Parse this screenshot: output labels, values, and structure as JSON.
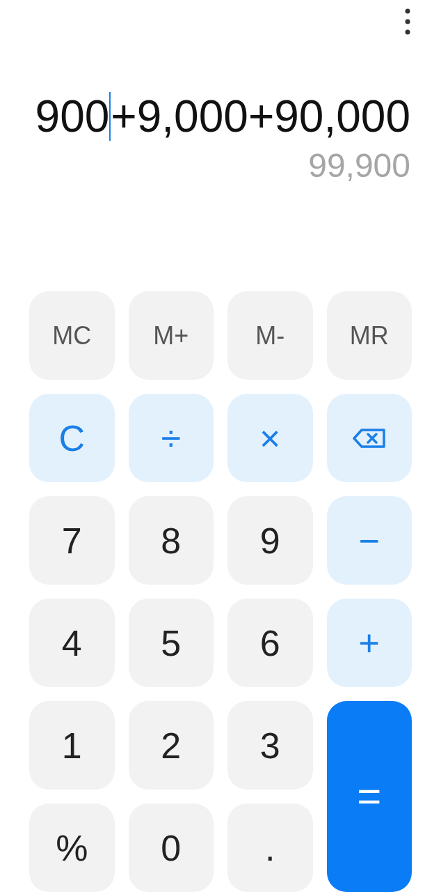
{
  "display": {
    "expression_before_cursor": "900",
    "expression_after_cursor": "+9,000+90,000",
    "result": "99,900"
  },
  "keys": [
    {
      "kind": "memory",
      "label": "MC"
    },
    {
      "kind": "memory",
      "label": "M+"
    },
    {
      "kind": "memory",
      "label": "M-"
    },
    {
      "kind": "memory",
      "label": "MR"
    },
    {
      "kind": "function",
      "label": "C"
    },
    {
      "kind": "function",
      "label": "÷"
    },
    {
      "kind": "function",
      "label": "×"
    },
    {
      "kind": "backspace"
    },
    {
      "kind": "digit",
      "label": "7"
    },
    {
      "kind": "digit",
      "label": "8"
    },
    {
      "kind": "digit",
      "label": "9"
    },
    {
      "kind": "function",
      "label": "−"
    },
    {
      "kind": "digit",
      "label": "4"
    },
    {
      "kind": "digit",
      "label": "5"
    },
    {
      "kind": "digit",
      "label": "6"
    },
    {
      "kind": "function",
      "label": "+"
    },
    {
      "kind": "digit",
      "label": "1"
    },
    {
      "kind": "digit",
      "label": "2"
    },
    {
      "kind": "digit",
      "label": "3"
    },
    {
      "kind": "equals",
      "label": "="
    },
    {
      "kind": "digit",
      "label": "%"
    },
    {
      "kind": "digit",
      "label": "0"
    },
    {
      "kind": "digit",
      "label": "."
    }
  ]
}
